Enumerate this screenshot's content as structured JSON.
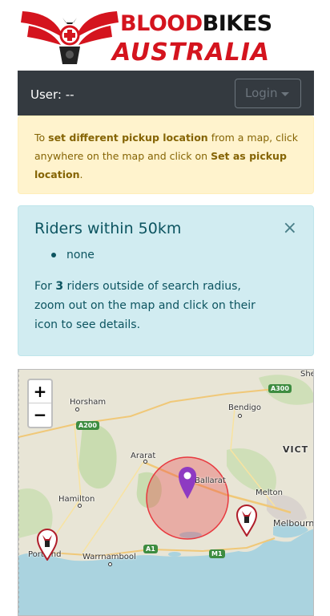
{
  "brand": {
    "line1": "BLOODBIKES",
    "line1_a": "BLOOD",
    "line1_b": "BIKES",
    "line2": "AUSTRALIA"
  },
  "userbar": {
    "user_label": "User: --",
    "login_label": "Login"
  },
  "notice": {
    "prefix": "To ",
    "bold1": "set different pickup location",
    "middle": " from a map, click anywhere on the map and click on ",
    "bold2": "Set as pickup location",
    "suffix": "."
  },
  "riders": {
    "title": "Riders within 50km",
    "close": "×",
    "items": [
      "none"
    ],
    "desc_prefix": "For ",
    "desc_count": "3",
    "desc_suffix": " riders outside of search radius, zoom out on the map and click on their icon to see details."
  },
  "map": {
    "zoom_in": "+",
    "zoom_out": "−",
    "places": {
      "horsham": "Horsham",
      "bendigo": "Bendigo",
      "ararat": "Ararat",
      "ballarat": "Ballarat",
      "hamilton": "Hamilton",
      "melton": "Melton",
      "melbourne": "Melbourne",
      "warrnambool": "Warrnambool",
      "portland": "Portland",
      "vic": "VICT",
      "she": "She"
    },
    "roads": {
      "a200": "A200",
      "a300": "A300",
      "a1": "A1",
      "m1": "M1"
    },
    "colors": {
      "radius": "#e8393f",
      "selected_pin": "#8e3ac2",
      "rider_icon": "#b01d2a"
    }
  }
}
